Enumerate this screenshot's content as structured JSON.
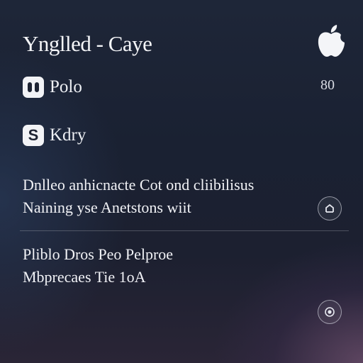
{
  "header": {
    "title": "Ynglled - Caye",
    "logo_icon": "apple-icon"
  },
  "rows": [
    {
      "icon": "toggle-icon",
      "label": "Polo",
      "value": "80"
    },
    {
      "icon": "s-badge-icon",
      "label": "Kdry"
    }
  ],
  "sections": [
    {
      "lines": [
        "Dnlleo anhicnacte Cot ond cliibilisus",
        "Naining yse Anetstons wiit"
      ],
      "button_icon": "expand-icon"
    },
    {
      "lines": [
        "Pliblo Dros Peo Pelproe",
        "Mbprecaes Tie 1oA"
      ],
      "button_icon": "radio-icon"
    }
  ],
  "colors": {
    "background_top": "#1e2638",
    "background_corner_glow": "#6e506e",
    "text": "#ffffff"
  }
}
